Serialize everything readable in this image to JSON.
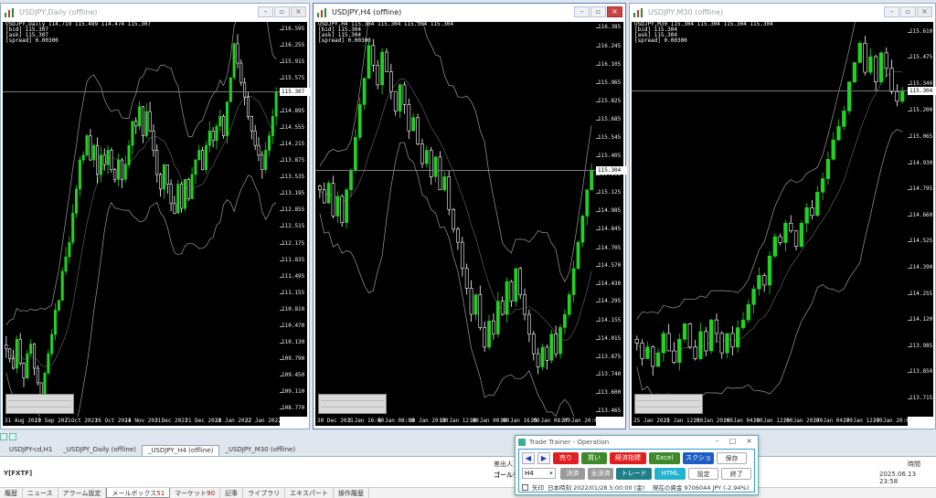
{
  "charts": [
    {
      "title": "USDJPY,Daily (offline)",
      "info_lines": [
        "USDJPY,Daily 114.719 115.489 114.474 115.307",
        "[bid] 115.307",
        "[ask] 115.307",
        "[spread] 0.00300"
      ],
      "y_ticks": [
        "116.595",
        "116.255",
        "115.915",
        "115.575",
        "115.235",
        "114.895",
        "114.555",
        "114.215",
        "113.875",
        "113.535",
        "113.195",
        "112.855",
        "112.515",
        "112.175",
        "111.835",
        "111.495",
        "111.155",
        "110.810",
        "110.470",
        "110.130",
        "109.790",
        "109.450",
        "109.110",
        "108.770"
      ],
      "y_range": [
        108.6,
        116.75
      ],
      "price_label": "115.307",
      "price": 115.307,
      "x_ticks": [
        "31 Aug 2021",
        "19 Sep 2021",
        "7 Oct 2021",
        "26 Oct 2021",
        "14 Nov 2021",
        "2 Dec 2021",
        "21 Dec 2021",
        "10 Jan 2022",
        "27 Jan 2022"
      ],
      "series_close": [
        110.0,
        109.8,
        109.6,
        110.2,
        109.7,
        109.4,
        109.9,
        110.1,
        109.6,
        109.3,
        109.0,
        109.5,
        109.9,
        110.3,
        110.8,
        111.0,
        111.6,
        111.9,
        112.2,
        112.8,
        113.3,
        113.9,
        114.0,
        114.4,
        113.9,
        114.2,
        113.6,
        114.0,
        113.8,
        114.1,
        113.7,
        113.5,
        113.9,
        113.5,
        113.8,
        114.2,
        114.7,
        114.6,
        115.0,
        114.4,
        114.9,
        114.5,
        114.1,
        113.6,
        113.3,
        113.8,
        113.4,
        113.0,
        112.8,
        113.4,
        112.9,
        113.5,
        113.1,
        113.6,
        113.9,
        114.1,
        113.7,
        114.2,
        114.5,
        114.3,
        114.6,
        114.8,
        114.4,
        115.1,
        115.6,
        116.3,
        115.9,
        115.5,
        115.2,
        114.8,
        114.5,
        114.2,
        114.0,
        113.7,
        114.1,
        114.4,
        114.8,
        115.3
      ]
    },
    {
      "title": "USDJPY,H4 (offline)",
      "info_lines": [
        "USDJPY,H4 115.304 115.304 115.304 115.304",
        "[bid] 115.304",
        "[ask] 115.304",
        "[spread] 0.00300"
      ],
      "y_ticks": [
        "116.385",
        "116.245",
        "116.105",
        "115.965",
        "115.825",
        "115.685",
        "115.545",
        "115.405",
        "115.265",
        "115.125",
        "114.985",
        "114.845",
        "114.705",
        "114.570",
        "114.430",
        "114.295",
        "114.155",
        "114.015",
        "113.875",
        "113.740",
        "113.600",
        "113.465"
      ],
      "y_range": [
        113.42,
        116.43
      ],
      "price_label": "115.304",
      "price": 115.304,
      "x_ticks": [
        "30 Dec 2021",
        "3 Jan 16:00",
        "6 Jan 08:00",
        "10 Jan 20:00",
        "13 Jan 12:00",
        "18 Jan 00:00",
        "20 Jan 16:00",
        "25 Jan 08:00",
        "27 Jan 20:00"
      ],
      "series_close": [
        115.15,
        115.05,
        115.2,
        114.95,
        115.1,
        114.9,
        115.15,
        115.3,
        115.55,
        115.8,
        116.0,
        116.25,
        116.1,
        115.95,
        116.2,
        116.05,
        115.9,
        115.75,
        115.95,
        115.8,
        115.6,
        115.7,
        115.5,
        115.35,
        115.45,
        115.25,
        115.4,
        115.15,
        115.25,
        115.0,
        114.85,
        114.75,
        114.55,
        114.4,
        114.2,
        114.35,
        114.1,
        113.95,
        114.15,
        114.05,
        114.3,
        114.2,
        114.45,
        114.3,
        114.55,
        114.35,
        114.2,
        114.05,
        113.9,
        113.8,
        113.95,
        113.85,
        114.05,
        113.9,
        114.1,
        114.2,
        114.35,
        114.55,
        114.75,
        114.95,
        115.15,
        115.3
      ]
    },
    {
      "title": "USDJPY,M30 (offline)",
      "info_lines": [
        "USDJPY,M30 115.304 115.304 115.304 115.304",
        "[bid] 115.304",
        "[ask] 115.304",
        "[spread] 0.00300"
      ],
      "y_ticks": [
        "115.610",
        "115.475",
        "115.340",
        "115.200",
        "115.065",
        "114.930",
        "114.795",
        "114.660",
        "114.525",
        "114.390",
        "114.255",
        "114.120",
        "113.985",
        "113.850",
        "113.715"
      ],
      "y_range": [
        113.62,
        115.66
      ],
      "price_label": "115.304",
      "price": 115.304,
      "x_ticks": [
        "25 Jan 2022",
        "25 Jan 12:00",
        "25 Jan 20:00",
        "26 Jan 04:00",
        "26 Jan 12:00",
        "26 Jan 20:00",
        "27 Jan 04:00",
        "27 Jan 12:00",
        "27 Jan 20:00"
      ],
      "series_close": [
        114.0,
        113.92,
        113.98,
        113.88,
        113.95,
        114.05,
        113.96,
        113.9,
        114.02,
        114.1,
        113.98,
        113.92,
        114.06,
        113.96,
        114.12,
        114.05,
        113.95,
        114.05,
        113.98,
        114.08,
        114.12,
        114.2,
        114.28,
        114.35,
        114.3,
        114.45,
        114.55,
        114.52,
        114.62,
        114.58,
        114.5,
        114.62,
        114.7,
        114.66,
        114.78,
        114.85,
        114.95,
        115.05,
        115.12,
        115.2,
        115.35,
        115.45,
        115.55,
        115.4,
        115.48,
        115.35,
        115.5,
        115.42,
        115.3,
        115.25,
        115.3
      ]
    }
  ],
  "chart_tabs": [
    "USDJPY-cd,H1",
    "_USDJPY_Daily (offline)",
    "_USDJPY_H4 (offline)",
    "_USDJPY_M30 (offline)"
  ],
  "chart_tab_selected": 2,
  "terminal": {
    "col_sashi": "差出人",
    "col_time": "時間",
    "row_sender": "ゴールデンウェイ",
    "row_time": "2025.06.13 23:58",
    "left_fragment": "Y[FXTF]",
    "tabs": [
      "履歴",
      "ニュース",
      "アラーム設定",
      "メールボックス",
      "マーケット",
      "記事",
      "ライブラリ",
      "エキスパート",
      "操作履歴"
    ],
    "tab_counts": {
      "3": "51",
      "4": "90"
    },
    "selected_tab": 3
  },
  "dialog": {
    "title": "Trade Trainer - Operation",
    "timeframe": "H4",
    "buttons": {
      "sell": "売り",
      "buy": "買い",
      "indicators": "経済指標",
      "excel": "Excel",
      "screenshot": "スクショ",
      "save": "保存",
      "settle": "決済",
      "settle_all": "全決済",
      "trade": "トレード",
      "html": "HTML",
      "settings": "設定",
      "exit": "終了"
    },
    "status_check_label": "矢印",
    "status_text": "日本時刻 2022/01/28 5:00:00 (金)　 現在の資金 9706044 JPY (-2.94%)"
  },
  "colors": {
    "bull": "#21d321",
    "bear": "#ffffff",
    "band": "#9a9a9a",
    "bg": "#000000"
  }
}
